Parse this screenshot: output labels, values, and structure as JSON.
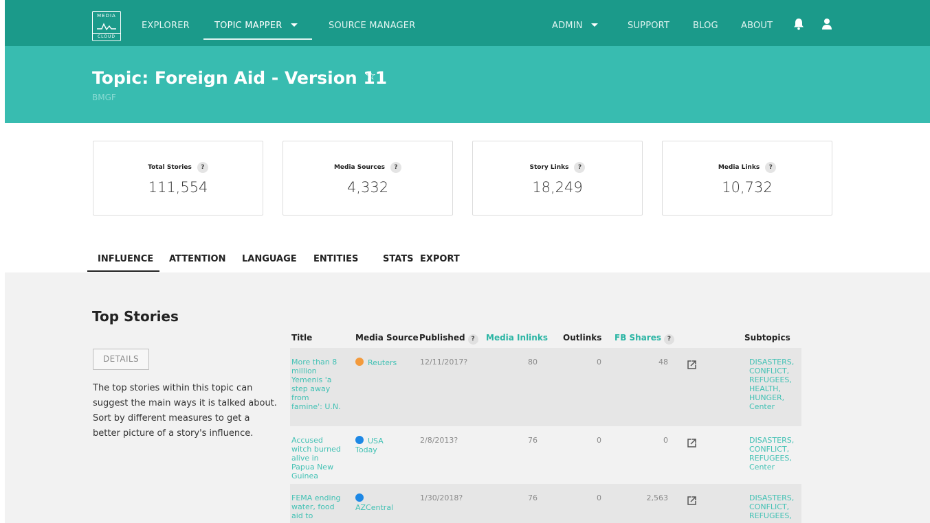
{
  "nav": {
    "logo_top": "MEDIA",
    "logo_bottom": "CLOUD",
    "explorer": "EXPLORER",
    "topic_mapper": "TOPIC MAPPER",
    "source_manager": "SOURCE MANAGER",
    "admin": "ADMIN",
    "support": "SUPPORT",
    "blog": "BLOG",
    "about": "ABOUT"
  },
  "header": {
    "title": "Topic: Foreign Aid - Version 11",
    "subtitle": "BMGF",
    "star": "☆"
  },
  "stats": [
    {
      "label": "Total Stories",
      "value": "111,554"
    },
    {
      "label": "Media Sources",
      "value": "4,332"
    },
    {
      "label": "Story Links",
      "value": "18,249"
    },
    {
      "label": "Media Links",
      "value": "10,732"
    }
  ],
  "tabs": [
    "INFLUENCE",
    "ATTENTION",
    "LANGUAGE",
    "ENTITIES",
    "STATS",
    "EXPORT"
  ],
  "top_stories": {
    "title": "Top Stories",
    "details_button": "DETAILS",
    "description": "The top stories within this topic can suggest the main ways it is talked about. Sort by different measures to get a better picture of a story's influence.",
    "columns": {
      "title": "Title",
      "media_source": "Media Source",
      "published": "Published",
      "media_inlinks": "Media Inlinks",
      "outlinks": "Outlinks",
      "fb_shares": "FB Shares",
      "subtopics": "Subtopics"
    },
    "help_glyph": "?",
    "rows": [
      {
        "title": "More than 8 million Yemenis 'a step away from famine': U.N.",
        "source": "Reuters",
        "source_color": "#f39a3c",
        "published": "12/11/2017?",
        "inlinks": "80",
        "outlinks": "0",
        "fb_shares": "48",
        "subtopics": [
          "DISASTERS",
          "CONFLICT",
          "REFUGEES",
          "HEALTH",
          "HUNGER",
          "Center"
        ]
      },
      {
        "title": "Accused witch burned alive in Papua New Guinea",
        "source": "USA Today",
        "source_color": "#1e88e5",
        "published": "2/8/2013?",
        "inlinks": "76",
        "outlinks": "0",
        "fb_shares": "0",
        "subtopics": [
          "DISASTERS",
          "CONFLICT",
          "REFUGEES",
          "Center"
        ]
      },
      {
        "title": "FEMA ending water, food aid to",
        "source": "AZCentral",
        "source_color": "#1e88e5",
        "published": "1/30/2018?",
        "inlinks": "76",
        "outlinks": "0",
        "fb_shares": "2,563",
        "subtopics": [
          "DISASTERS",
          "CONFLICT",
          "REFUGEES"
        ]
      }
    ]
  }
}
